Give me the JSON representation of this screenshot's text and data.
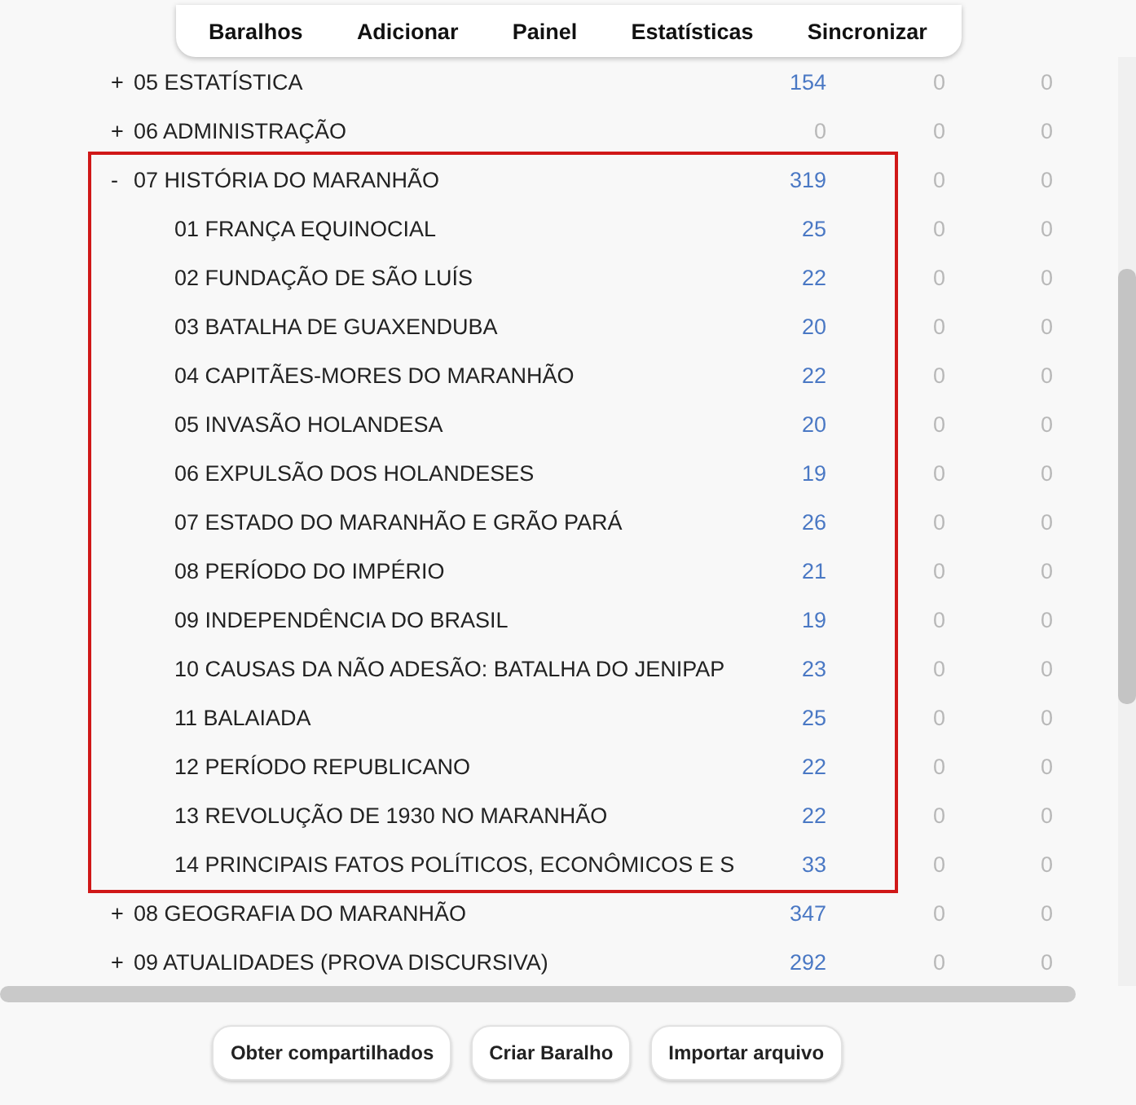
{
  "toolbar": {
    "tabs": [
      {
        "label": "Baralhos"
      },
      {
        "label": "Adicionar"
      },
      {
        "label": "Painel"
      },
      {
        "label": "Estatísticas"
      },
      {
        "label": "Sincronizar"
      }
    ]
  },
  "decks": [
    {
      "toggle": "+",
      "name": "05 ESTATÍSTICA",
      "highlighted": false,
      "counts": [
        {
          "text": "154",
          "dim": false
        },
        {
          "text": "0",
          "dim": true
        },
        {
          "text": "0",
          "dim": true
        }
      ]
    },
    {
      "toggle": "+",
      "name": "06 ADMINISTRAÇÃO",
      "highlighted": false,
      "counts": [
        {
          "text": "0",
          "dim": true
        },
        {
          "text": "0",
          "dim": true
        },
        {
          "text": "0",
          "dim": true
        }
      ]
    },
    {
      "toggle": "-",
      "name": "07 HISTÓRIA DO MARANHÃO",
      "highlighted": true,
      "counts": [
        {
          "text": "319",
          "dim": false
        },
        {
          "text": "0",
          "dim": true
        },
        {
          "text": "0",
          "dim": true
        }
      ],
      "children": [
        {
          "name": "01 FRANÇA EQUINOCIAL",
          "counts": [
            {
              "text": "25",
              "dim": false
            },
            {
              "text": "0",
              "dim": true
            },
            {
              "text": "0",
              "dim": true
            }
          ]
        },
        {
          "name": "02 FUNDAÇÃO DE SÃO LUÍS",
          "counts": [
            {
              "text": "22",
              "dim": false
            },
            {
              "text": "0",
              "dim": true
            },
            {
              "text": "0",
              "dim": true
            }
          ]
        },
        {
          "name": "03 BATALHA DE GUAXENDUBA",
          "counts": [
            {
              "text": "20",
              "dim": false
            },
            {
              "text": "0",
              "dim": true
            },
            {
              "text": "0",
              "dim": true
            }
          ]
        },
        {
          "name": "04 CAPITÃES-MORES DO MARANHÃO",
          "counts": [
            {
              "text": "22",
              "dim": false
            },
            {
              "text": "0",
              "dim": true
            },
            {
              "text": "0",
              "dim": true
            }
          ]
        },
        {
          "name": "05 INVASÃO HOLANDESA",
          "counts": [
            {
              "text": "20",
              "dim": false
            },
            {
              "text": "0",
              "dim": true
            },
            {
              "text": "0",
              "dim": true
            }
          ]
        },
        {
          "name": "06 EXPULSÃO DOS HOLANDESES",
          "counts": [
            {
              "text": "19",
              "dim": false
            },
            {
              "text": "0",
              "dim": true
            },
            {
              "text": "0",
              "dim": true
            }
          ]
        },
        {
          "name": "07 ESTADO DO MARANHÃO E GRÃO PARÁ",
          "counts": [
            {
              "text": "26",
              "dim": false
            },
            {
              "text": "0",
              "dim": true
            },
            {
              "text": "0",
              "dim": true
            }
          ]
        },
        {
          "name": "08 PERÍODO DO IMPÉRIO",
          "counts": [
            {
              "text": "21",
              "dim": false
            },
            {
              "text": "0",
              "dim": true
            },
            {
              "text": "0",
              "dim": true
            }
          ]
        },
        {
          "name": "09 INDEPENDÊNCIA DO BRASIL",
          "counts": [
            {
              "text": "19",
              "dim": false
            },
            {
              "text": "0",
              "dim": true
            },
            {
              "text": "0",
              "dim": true
            }
          ]
        },
        {
          "name": "10 CAUSAS DA NÃO ADESÃO: BATALHA DO JENIPAP",
          "counts": [
            {
              "text": "23",
              "dim": false
            },
            {
              "text": "0",
              "dim": true
            },
            {
              "text": "0",
              "dim": true
            }
          ]
        },
        {
          "name": "11 BALAIADA",
          "counts": [
            {
              "text": "25",
              "dim": false
            },
            {
              "text": "0",
              "dim": true
            },
            {
              "text": "0",
              "dim": true
            }
          ]
        },
        {
          "name": "12 PERÍODO REPUBLICANO",
          "counts": [
            {
              "text": "22",
              "dim": false
            },
            {
              "text": "0",
              "dim": true
            },
            {
              "text": "0",
              "dim": true
            }
          ]
        },
        {
          "name": "13 REVOLUÇÃO DE 1930 NO MARANHÃO",
          "counts": [
            {
              "text": "22",
              "dim": false
            },
            {
              "text": "0",
              "dim": true
            },
            {
              "text": "0",
              "dim": true
            }
          ]
        },
        {
          "name": "14 PRINCIPAIS FATOS POLÍTICOS, ECONÔMICOS E S",
          "counts": [
            {
              "text": "33",
              "dim": false
            },
            {
              "text": "0",
              "dim": true
            },
            {
              "text": "0",
              "dim": true
            }
          ]
        }
      ]
    },
    {
      "toggle": "+",
      "name": "08 GEOGRAFIA DO MARANHÃO",
      "highlighted": false,
      "counts": [
        {
          "text": "347",
          "dim": false
        },
        {
          "text": "0",
          "dim": true
        },
        {
          "text": "0",
          "dim": true
        }
      ]
    },
    {
      "toggle": "+",
      "name": "09 ATUALIDADES (PROVA DISCURSIVA)",
      "highlighted": false,
      "counts": [
        {
          "text": "292",
          "dim": false
        },
        {
          "text": "0",
          "dim": true
        },
        {
          "text": "0",
          "dim": true
        }
      ]
    }
  ],
  "buttons": [
    {
      "label": "Obter compartilhados"
    },
    {
      "label": "Criar Baralho"
    },
    {
      "label": "Importar arquivo"
    }
  ]
}
